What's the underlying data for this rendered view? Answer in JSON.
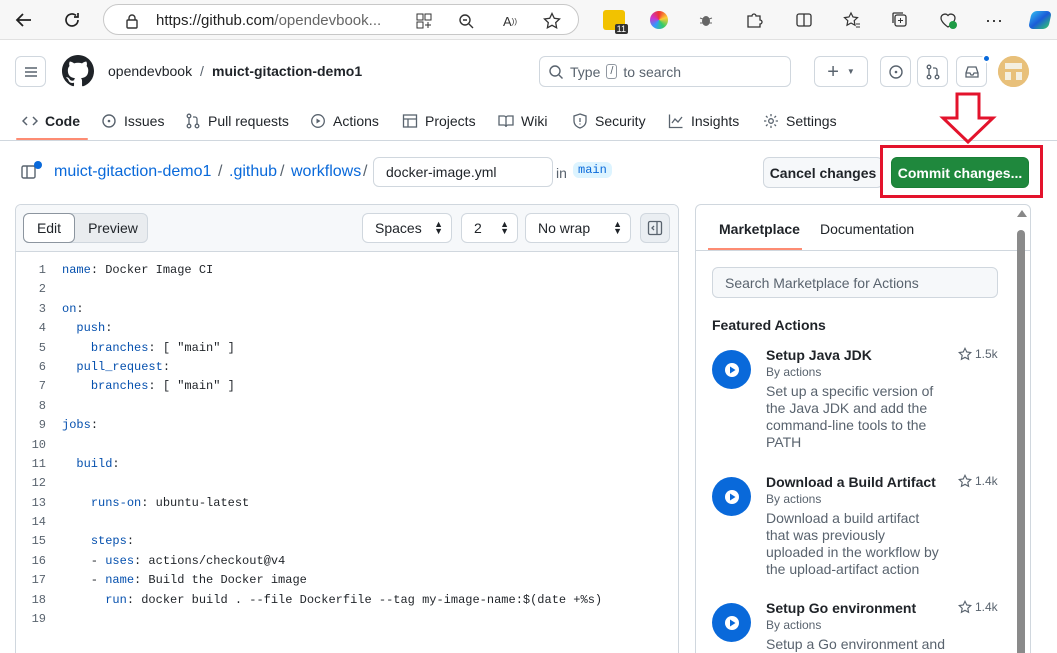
{
  "browser": {
    "url_host": "https://github.com",
    "url_path": "/opendevbook...",
    "extension_badge": "11"
  },
  "header": {
    "owner": "opendevbook",
    "separator": "/",
    "repo": "muict-gitaction-demo1",
    "search_prefix": "Type",
    "search_key": "/",
    "search_suffix": "to search",
    "plus_label": "+"
  },
  "tabs": [
    {
      "label": "Code",
      "icon": "code-icon",
      "active": true
    },
    {
      "label": "Issues",
      "icon": "issue-icon"
    },
    {
      "label": "Pull requests",
      "icon": "pull-request-icon"
    },
    {
      "label": "Actions",
      "icon": "play-icon"
    },
    {
      "label": "Projects",
      "icon": "table-icon"
    },
    {
      "label": "Wiki",
      "icon": "book-icon"
    },
    {
      "label": "Security",
      "icon": "shield-icon"
    },
    {
      "label": "Insights",
      "icon": "graph-icon"
    },
    {
      "label": "Settings",
      "icon": "gear-icon"
    }
  ],
  "file_bar": {
    "repo_crumb": "muict-gitaction-demo1",
    "dir1": ".github",
    "dir2": "workflows",
    "sep": "/",
    "filename": "docker-image.yml",
    "in_label": "in",
    "branch": "main",
    "cancel_label": "Cancel changes",
    "commit_label": "Commit changes..."
  },
  "editor_toolbar": {
    "edit_label": "Edit",
    "preview_label": "Preview",
    "indent_mode": "Spaces",
    "indent_size": "2",
    "wrap_mode": "No wrap"
  },
  "code_lines": [
    {
      "n": "1",
      "key": "name",
      "rest": ": Docker Image CI",
      "indent": ""
    },
    {
      "n": "2",
      "key": "",
      "rest": "",
      "indent": ""
    },
    {
      "n": "3",
      "key": "on",
      "rest": ":",
      "indent": ""
    },
    {
      "n": "4",
      "key": "push",
      "rest": ":",
      "indent": "  "
    },
    {
      "n": "5",
      "key": "branches",
      "rest": ": [ \"main\" ]",
      "indent": "    "
    },
    {
      "n": "6",
      "key": "pull_request",
      "rest": ":",
      "indent": "  "
    },
    {
      "n": "7",
      "key": "branches",
      "rest": ": [ \"main\" ]",
      "indent": "    "
    },
    {
      "n": "8",
      "key": "",
      "rest": "",
      "indent": ""
    },
    {
      "n": "9",
      "key": "jobs",
      "rest": ":",
      "indent": ""
    },
    {
      "n": "10",
      "key": "",
      "rest": "",
      "indent": ""
    },
    {
      "n": "11",
      "key": "build",
      "rest": ":",
      "indent": "  "
    },
    {
      "n": "12",
      "key": "",
      "rest": "",
      "indent": ""
    },
    {
      "n": "13",
      "key": "runs-on",
      "rest": ": ubuntu-latest",
      "indent": "    "
    },
    {
      "n": "14",
      "key": "",
      "rest": "",
      "indent": ""
    },
    {
      "n": "15",
      "key": "steps",
      "rest": ":",
      "indent": "    "
    },
    {
      "n": "16",
      "key": "uses",
      "rest": ": actions/checkout@v4",
      "indent": "    - "
    },
    {
      "n": "17",
      "key": "name",
      "rest": ": Build the Docker image",
      "indent": "    - "
    },
    {
      "n": "18",
      "key": "run",
      "rest": ": docker build . --file Dockerfile --tag my-image-name:$(date +%s)",
      "indent": "      "
    },
    {
      "n": "19",
      "key": "",
      "rest": "",
      "indent": ""
    }
  ],
  "side_panel": {
    "tab_marketplace": "Marketplace",
    "tab_documentation": "Documentation",
    "search_placeholder": "Search Marketplace for Actions",
    "featured_title": "Featured Actions",
    "actions": [
      {
        "name": "Setup Java JDK",
        "by": "By actions",
        "desc": "Set up a specific version of the Java JDK and add the command-line tools to the PATH",
        "stars": "1.5k"
      },
      {
        "name": "Download a Build Artifact",
        "by": "By actions",
        "desc": "Download a build artifact that was previously uploaded in the workflow by the upload-artifact action",
        "stars": "1.4k"
      },
      {
        "name": "Setup Go environment",
        "by": "By actions",
        "desc": "Setup a Go environment and",
        "stars": "1.4k"
      }
    ]
  },
  "colors": {
    "commit_green": "#1f883d",
    "link_blue": "#0969da",
    "annotation_red": "#e3132c",
    "tab_underline": "#fd8c73"
  }
}
